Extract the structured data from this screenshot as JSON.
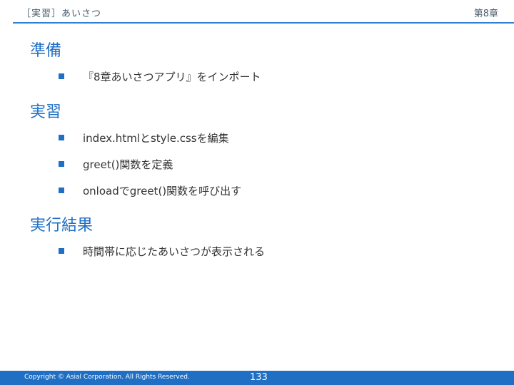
{
  "header": {
    "title": "［実習］あいさつ",
    "chapter": "第8章"
  },
  "sections": [
    {
      "heading": "準備",
      "items": [
        "『8章あいさつアプリ』をインポート"
      ]
    },
    {
      "heading": "実習",
      "items": [
        "index.htmlとstyle.cssを編集",
        "greet()関数を定義",
        "onloadでgreet()関数を呼び出す"
      ]
    },
    {
      "heading": "実行結果",
      "items": [
        "時間帯に応じたあいさつが表示される"
      ]
    }
  ],
  "footer": {
    "copyright": "Copyright © Asial Corporation. All Rights Reserved.",
    "page_number": "133"
  },
  "colors": {
    "accent": "#1f6fc4",
    "header_line": "#2f7fd4"
  }
}
